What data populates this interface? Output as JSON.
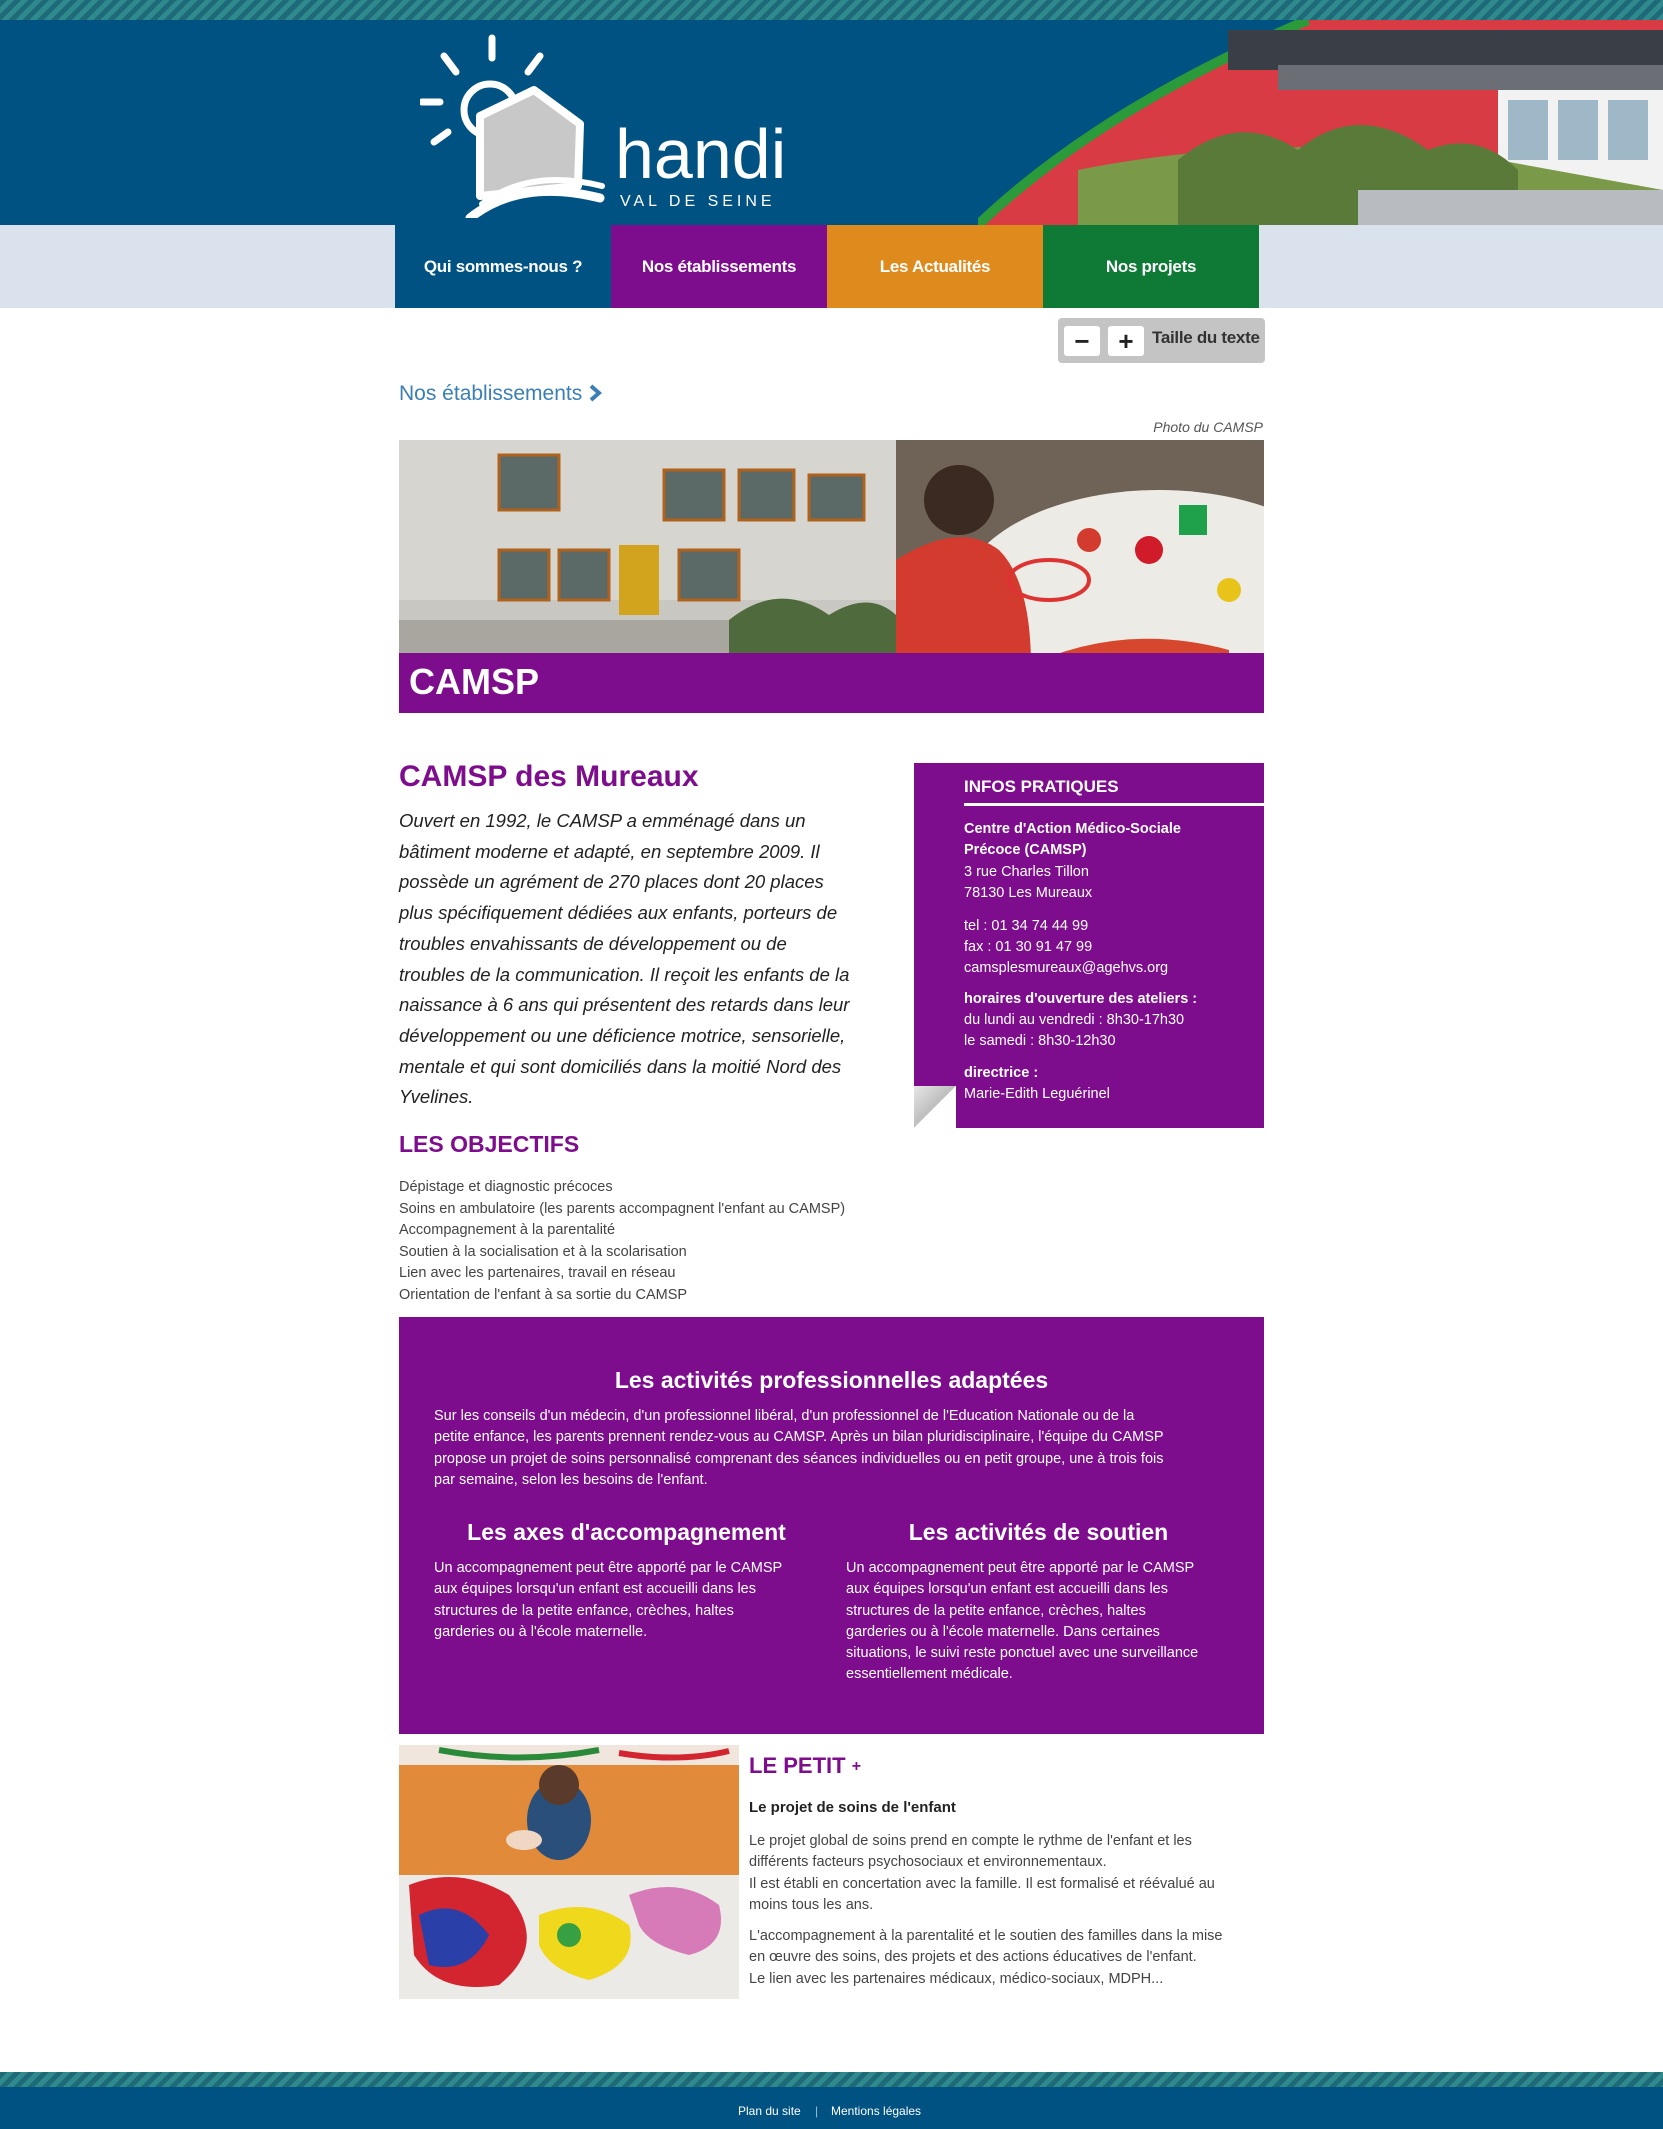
{
  "brand": {
    "logo_word": "handi",
    "logo_sub": "VAL DE SEINE",
    "header_color": "#005283"
  },
  "nav": {
    "items": [
      {
        "label": "Qui sommes-nous ?",
        "color": "#005283"
      },
      {
        "label": "Nos établissements",
        "color": "#7e0d8e"
      },
      {
        "label": "Les Actualités",
        "color": "#de8a1d"
      },
      {
        "label": "Nos projets",
        "color": "#0e7a36"
      }
    ]
  },
  "text_size": {
    "minus": "−",
    "plus": "+",
    "label": "Taille du texte"
  },
  "breadcrumb": {
    "label": "Nos établissements",
    "chevron_icon": "chevron-right-icon"
  },
  "banner": {
    "credit": "Photo du CAMSP",
    "title": "CAMSP"
  },
  "intro": {
    "title": "CAMSP des Mureaux",
    "lines": [
      "Ouvert en 1992, le CAMSP a emménagé dans un",
      "bâtiment moderne et adapté, en septembre 2009. Il",
      "possède un agrément de 270 places dont 20 places",
      "plus spécifiquement dédiées aux enfants, porteurs de",
      "troubles envahissants de développement ou de",
      "troubles de la communication. Il reçoit les enfants de la",
      "naissance à 6 ans qui présentent des retards dans leur",
      "développement ou une déficience motrice, sensorielle,",
      "mentale et qui sont domiciliés dans la moitié Nord des",
      "Yvelines."
    ]
  },
  "objectifs": {
    "title": "LES OBJECTIFS",
    "items": [
      "Dépistage et diagnostic précoces",
      "Soins en ambulatoire (les parents accompagnent l'enfant au CAMSP)",
      "Accompagnement à la parentalité",
      "Soutien à la socialisation et à la scolarisation",
      "Lien avec les partenaires, travail en réseau",
      "Orientation de l'enfant à sa sortie du CAMSP"
    ]
  },
  "infos": {
    "title": "INFOS PRATIQUES",
    "name_line1": "Centre d'Action Médico-Sociale",
    "name_line2": "Précoce (CAMSP)",
    "address1": "3 rue Charles Tillon",
    "address2": "78130 Les Mureaux",
    "tel": "tel : 01 34 74 44 99",
    "fax": "fax : 01 30 91 47 99",
    "email": "camsplesmureaux@agehvs.org",
    "hours_title": "horaires d'ouverture des ateliers :",
    "hours1": "du lundi au vendredi : 8h30-17h30",
    "hours2": "le samedi : 8h30-12h30",
    "director_title": "directrice :",
    "director": "Marie-Edith Leguérinel"
  },
  "activities": {
    "title": "Les activités professionnelles adaptées",
    "text_lines": [
      "Sur les conseils d'un médecin, d'un professionnel libéral, d'un professionnel de l'Education Nationale ou de la",
      "petite enfance, les parents prennent rendez-vous au CAMSP. Après un bilan pluridisciplinaire, l'équipe du CAMSP",
      "propose un projet de soins personnalisé comprenant des séances individuelles ou en petit groupe, une à trois fois",
      "par semaine, selon les besoins de l'enfant."
    ],
    "axes_title": "Les axes d'accompagnement",
    "axes_lines": [
      "Un accompagnement peut être apporté par le CAMSP",
      "aux équipes lorsqu'un enfant est accueilli dans les",
      "structures de la petite enfance, crèches, haltes",
      "garderies ou à l'école maternelle."
    ],
    "soutien_title": "Les activités de soutien",
    "soutien_lines": [
      "Un accompagnement peut être apporté par le CAMSP",
      "aux équipes lorsqu'un enfant est accueilli dans les",
      "structures de la petite enfance, crèches, haltes",
      "garderies ou à l'école maternelle. Dans certaines",
      "situations, le suivi reste ponctuel avec une surveillance",
      "essentiellement médicale."
    ]
  },
  "petit": {
    "title": "LE PETIT",
    "plus": "+",
    "subtitle": "Le projet de soins de l'enfant",
    "p1": [
      "Le projet global de soins prend en compte le rythme de l'enfant et les",
      "différents facteurs psychosociaux et environnementaux.",
      "Il est établi en concertation avec la famille. Il est formalisé et réévalué au",
      "moins tous les ans."
    ],
    "p2": [
      "L'accompagnement à la parentalité et le soutien des familles dans la mise",
      "en œuvre des soins, des projets et des actions éducatives de l'enfant.",
      "Le lien avec les partenaires médicaux, médico-sociaux, MDPH..."
    ]
  },
  "footer": {
    "sitemap": "Plan du site",
    "separator": "|",
    "legal": "Mentions légales"
  }
}
